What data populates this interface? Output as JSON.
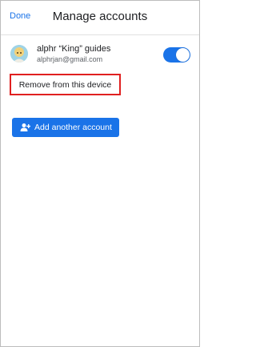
{
  "header": {
    "done_label": "Done",
    "title": "Manage accounts"
  },
  "account": {
    "name": "alphr “King” guides",
    "email": "alphrjan@gmail.com",
    "sync_enabled": true,
    "avatar_icon": "profile-avatar-icon"
  },
  "actions": {
    "remove_label": "Remove from this device",
    "add_label": "Add another account",
    "add_icon": "person-add-icon"
  },
  "colors": {
    "accent": "#1a73e8",
    "highlight": "#e02020"
  }
}
